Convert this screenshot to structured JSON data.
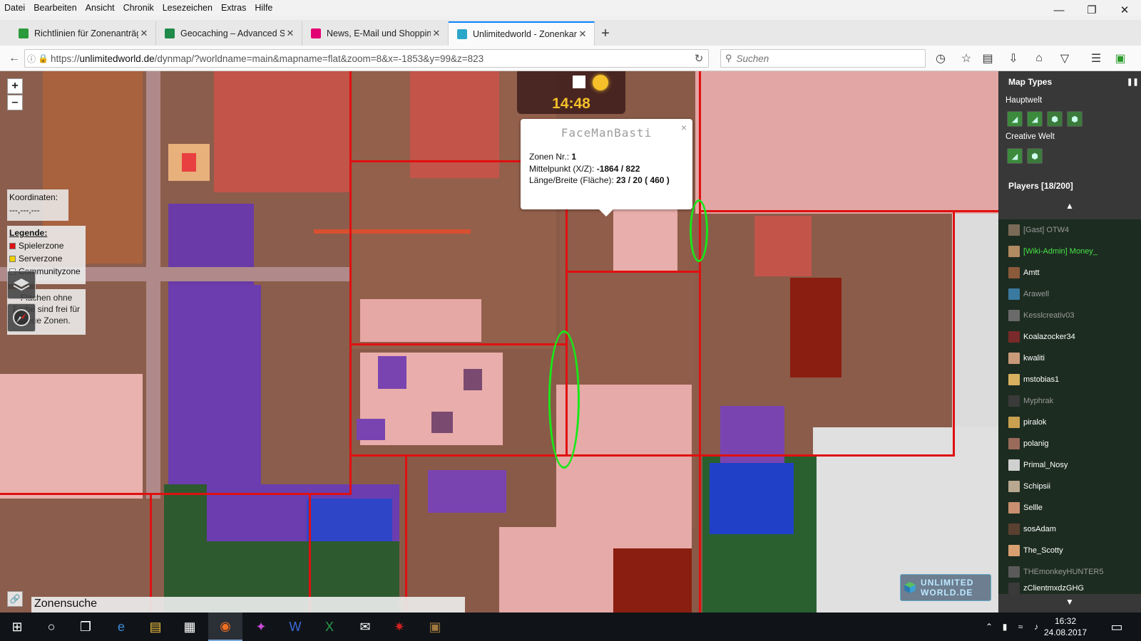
{
  "menu": [
    "Datei",
    "Bearbeiten",
    "Ansicht",
    "Chronik",
    "Lesezeichen",
    "Extras",
    "Hilfe"
  ],
  "tabs": [
    {
      "label": "Richtlinien für Zonenanträge",
      "favicon_color": "#2b9a3a",
      "active": false
    },
    {
      "label": "Geocaching – Advanced Search",
      "favicon_color": "#1f8a4a",
      "active": false
    },
    {
      "label": "News, E-Mail und Shopping",
      "favicon_color": "#e20074",
      "active": false
    },
    {
      "label": "Unlimitedworld - Zonenkarte",
      "favicon_color": "#2aa6c8",
      "active": true
    }
  ],
  "url": {
    "prefix": "https://",
    "domain": "unlimitedworld.de",
    "path": "/dynmap/?worldname=main&mapname=flat&zoom=8&x=-1853&y=99&z=823"
  },
  "search": {
    "placeholder": "Suchen"
  },
  "map": {
    "zoom_in": "+",
    "zoom_out": "–",
    "coordinates_label": "Koordinaten:",
    "coordinates_value": "---,---,---",
    "legend": {
      "title": "Legende:",
      "items": [
        {
          "label": "Spielerzone",
          "color": "#e01010"
        },
        {
          "label": "Serverzone",
          "color": "#f0d000"
        },
        {
          "label": "Communityzone",
          "color": "#ffffff"
        }
      ]
    },
    "legend_note": "Flächen ohne Farbe sind frei für neue Zonen.",
    "clock_time": "14:48",
    "zone_search": "Zonensuche"
  },
  "popup": {
    "name": "FaceManBasti",
    "zone_label": "Zonen Nr.:",
    "zone_value": "1",
    "center_label": "Mittelpunkt (X/Z):",
    "center_value": "-1864 / 822",
    "size_label": "Länge/Breite (Fläche):",
    "size_value": "23 / 20 ( 460 )",
    "close": "×"
  },
  "sidebar": {
    "map_types_title": "Map Types",
    "world_main": "Hauptwelt",
    "world_creative": "Creative Welt",
    "players_title": "Players [18/200]",
    "players": [
      {
        "name": "[Gast] OTW4",
        "style": "dim",
        "color": "#7a6a58"
      },
      {
        "name": "[Wiki-Admin] Money_",
        "style": "admin",
        "color": "#b08a60"
      },
      {
        "name": "Amtt",
        "style": "normal",
        "color": "#8a5a3a"
      },
      {
        "name": "Arawell",
        "style": "dim",
        "color": "#3a7aa0"
      },
      {
        "name": "Kesslcreativ03",
        "style": "dim",
        "color": "#6a6a6a"
      },
      {
        "name": "Koalazocker34",
        "style": "normal",
        "color": "#7a2a2a"
      },
      {
        "name": "kwaliti",
        "style": "normal",
        "color": "#c89a7a"
      },
      {
        "name": "mstobias1",
        "style": "normal",
        "color": "#d8b060"
      },
      {
        "name": "Myphrak",
        "style": "dim",
        "color": "#3a3a3a"
      },
      {
        "name": "piralok",
        "style": "normal",
        "color": "#c8a050"
      },
      {
        "name": "polanig",
        "style": "normal",
        "color": "#9a6a5a"
      },
      {
        "name": "Primal_Nosy",
        "style": "normal",
        "color": "#d0d0d0"
      },
      {
        "name": "Schipsii",
        "style": "normal",
        "color": "#b8a890"
      },
      {
        "name": "Sellle",
        "style": "normal",
        "color": "#c89070"
      },
      {
        "name": "sosAdam",
        "style": "normal",
        "color": "#5a4030"
      },
      {
        "name": "The_Scotty",
        "style": "normal",
        "color": "#d8a070"
      },
      {
        "name": "THEmonkeyHUNTER5",
        "style": "dim",
        "color": "#5a5a5a"
      },
      {
        "name": "zClientmxdzGHG",
        "style": "normal",
        "color": "#3a3a3a"
      }
    ]
  },
  "logo_text": "UNLIMITED WORLD.DE",
  "taskbar": {
    "time": "16:32",
    "date": "24.08.2017"
  }
}
